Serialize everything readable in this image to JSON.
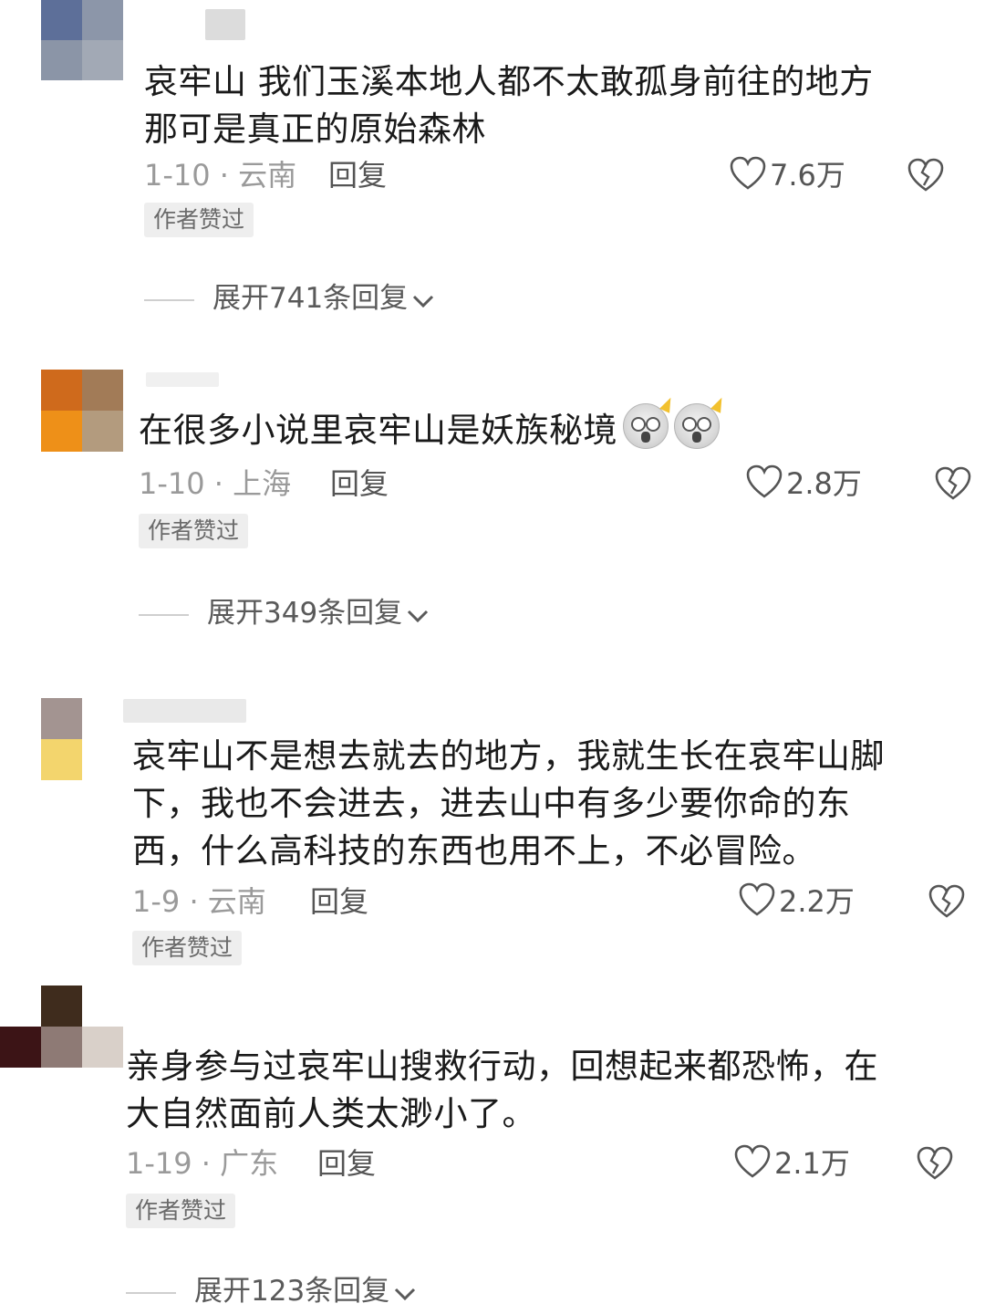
{
  "comments": [
    {
      "text": "哀牢山 我们玉溪本地人都不太敢孤身前往的地方\n那可是真正的原始森林",
      "date_location": "1-10 · 云南",
      "reply_label": "回复",
      "likes": "7.6万",
      "badge": "作者赞过",
      "expand_label": "展开741条回复"
    },
    {
      "text": "在很多小说里哀牢山是妖族秘境",
      "emoji": "scared-face-emoji",
      "date_location": "1-10 · 上海",
      "reply_label": "回复",
      "likes": "2.8万",
      "badge": "作者赞过",
      "expand_label": "展开349条回复"
    },
    {
      "text": "哀牢山不是想去就去的地方，我就生长在哀牢山脚\n下，我也不会进去，进去山中有多少要你命的东\n西，什么高科技的东西也用不上，不必冒险。",
      "date_location": "1-9 · 云南",
      "reply_label": "回复",
      "likes": "2.2万",
      "badge": "作者赞过"
    },
    {
      "text": "亲身参与过哀牢山搜救行动，回想起来都恐怖，在\n大自然面前人类太渺小了。",
      "date_location": "1-19 · 广东",
      "reply_label": "回复",
      "likes": "2.1万",
      "badge": "作者赞过",
      "expand_label": "展开123条回复"
    }
  ],
  "icons": {
    "like": "heart-outline-icon",
    "dislike": "broken-heart-icon",
    "expand": "chevron-down-icon"
  },
  "colors": {
    "text": "#1a1a1a",
    "muted": "#9a9a9a",
    "badge_bg": "#eeeeee"
  }
}
